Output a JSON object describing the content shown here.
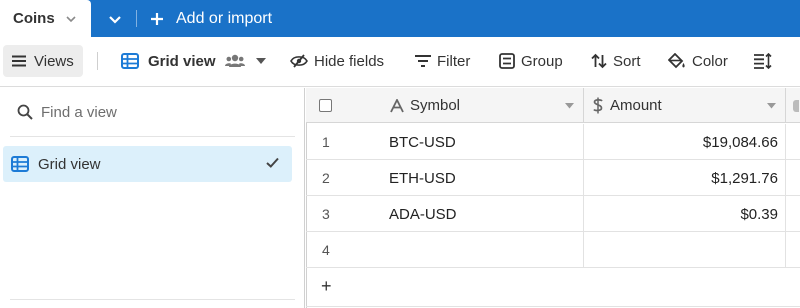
{
  "tabs": {
    "active_label": "Coins",
    "add_label": "Add or import"
  },
  "toolbar": {
    "views_label": "Views",
    "view_name": "Grid view",
    "hide_fields_label": "Hide fields",
    "filter_label": "Filter",
    "group_label": "Group",
    "sort_label": "Sort",
    "color_label": "Color"
  },
  "sidebar": {
    "find_placeholder": "Find a view",
    "views": [
      {
        "label": "Grid view",
        "selected": true
      }
    ]
  },
  "grid": {
    "columns": [
      {
        "name": "Symbol",
        "type": "text-icon"
      },
      {
        "name": "Amount",
        "type": "currency-icon"
      }
    ],
    "rows": [
      {
        "num": "1",
        "symbol": "BTC-USD",
        "amount": "$19,084.66"
      },
      {
        "num": "2",
        "symbol": "ETH-USD",
        "amount": "$1,291.76"
      },
      {
        "num": "3",
        "symbol": "ADA-USD",
        "amount": "$0.39"
      },
      {
        "num": "4",
        "symbol": "",
        "amount": ""
      }
    ],
    "add_row_label": "+"
  },
  "colors": {
    "brand_blue": "#1a72c8",
    "grid_icon_blue": "#1d7bd6",
    "selected_view_bg": "#dcf0fb"
  }
}
